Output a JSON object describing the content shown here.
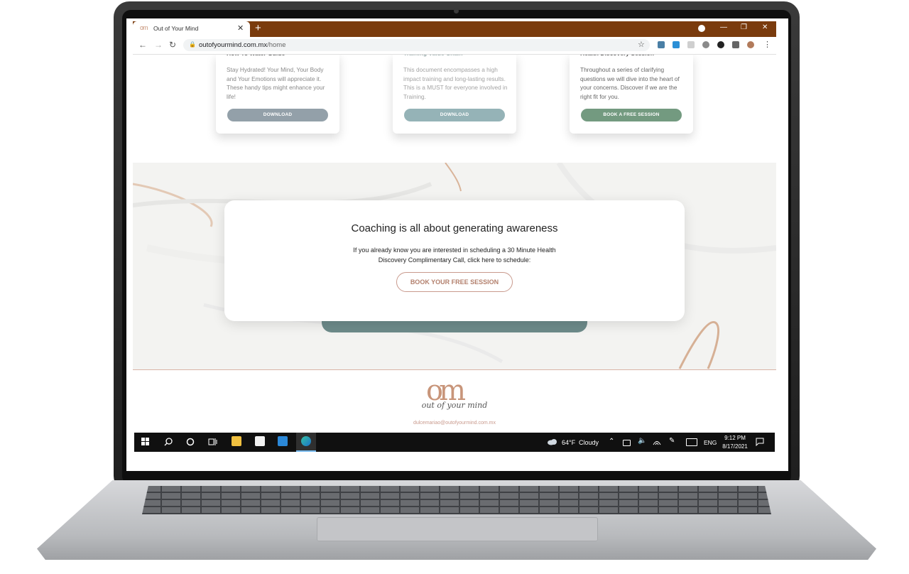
{
  "browser": {
    "tab_logo": "om",
    "tab_title": "Out of Your Mind",
    "tab_close": "✕",
    "new_tab": "+",
    "window_controls": {
      "minimize": "—",
      "restore": "❐",
      "close": "✕"
    },
    "nav": {
      "back": "←",
      "forward": "→",
      "reload": "↻"
    },
    "lock": "🔒",
    "url_domain": "outofyourmind.com.mx",
    "url_path": "/home",
    "star": "☆",
    "menu": "⋮"
  },
  "cards": [
    {
      "title": "How To Water Guide",
      "text": "Stay Hydrated! Your Mind, Your Body and Your Emotions will appreciate it. These handy tips might enhance your life!",
      "button": "DOWNLOAD",
      "button_color": "#93a0a9"
    },
    {
      "title": "Training Value Chain",
      "text": "This document encompasses a high impact training and long-lasting results. This is a MUST for everyone involved in Training.",
      "button": "DOWNLOAD",
      "button_color": "#95b3b7"
    },
    {
      "title": "Health Discovery Session",
      "text": "Throughout a series of clarifying questions we will dive into the heart of your concerns. Discover if we are the right fit for you.",
      "button": "BOOK A FREE SESSION",
      "button_color": "#739a80"
    }
  ],
  "cta": {
    "title": "Coaching is all about generating awareness",
    "description": "If you already know you are interested in scheduling a 30 Minute Health Discovery Complimentary Call, click here to schedule:",
    "button": "BOOK YOUR FREE SESSION"
  },
  "footer": {
    "logo": "om",
    "tagline": "out of your mind",
    "email": "dulcemariao@outofyourmind.com.mx"
  },
  "taskbar": {
    "weather_temp": "64°F",
    "weather_cond": "Cloudy",
    "language": "ENG",
    "time": "9:12 PM",
    "date": "8/17/2021"
  },
  "colors": {
    "tabstrip": "#7a3b0d",
    "accent_rose": "#c99a8d",
    "teal_bar": "#6d8b8a"
  }
}
